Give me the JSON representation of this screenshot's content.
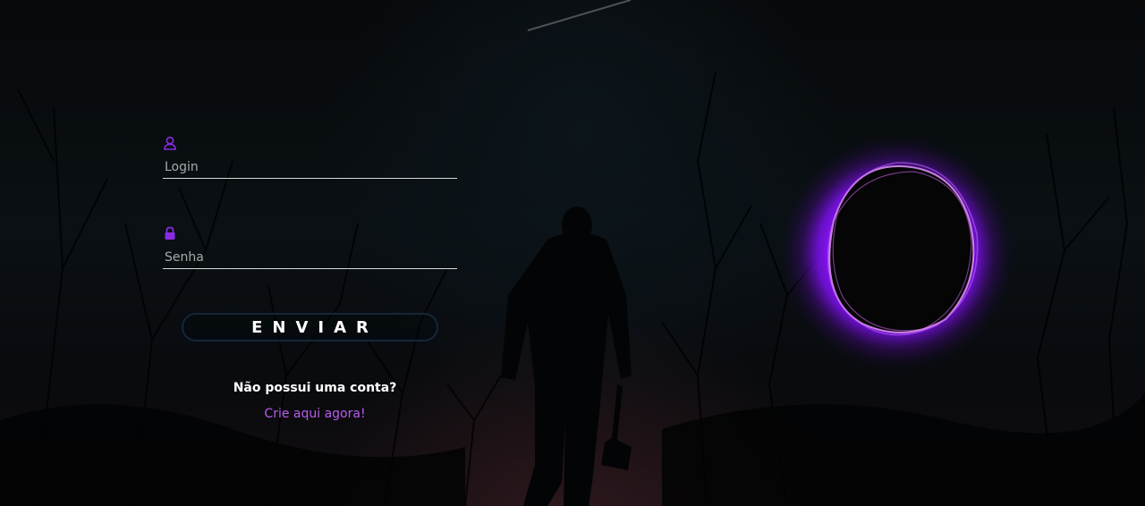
{
  "form": {
    "login_placeholder": "Login",
    "password_placeholder": "Senha",
    "submit_label": "ENVIAR",
    "no_account_text": "Não possui uma conta?",
    "create_account_link": "Crie aqui agora!"
  },
  "icons": {
    "login": "user-icon",
    "password": "lock-icon"
  },
  "colors": {
    "accent": "#8a2be2",
    "link": "#b85cf0",
    "glow": "#9b1cff",
    "button_border": "#14263a"
  }
}
